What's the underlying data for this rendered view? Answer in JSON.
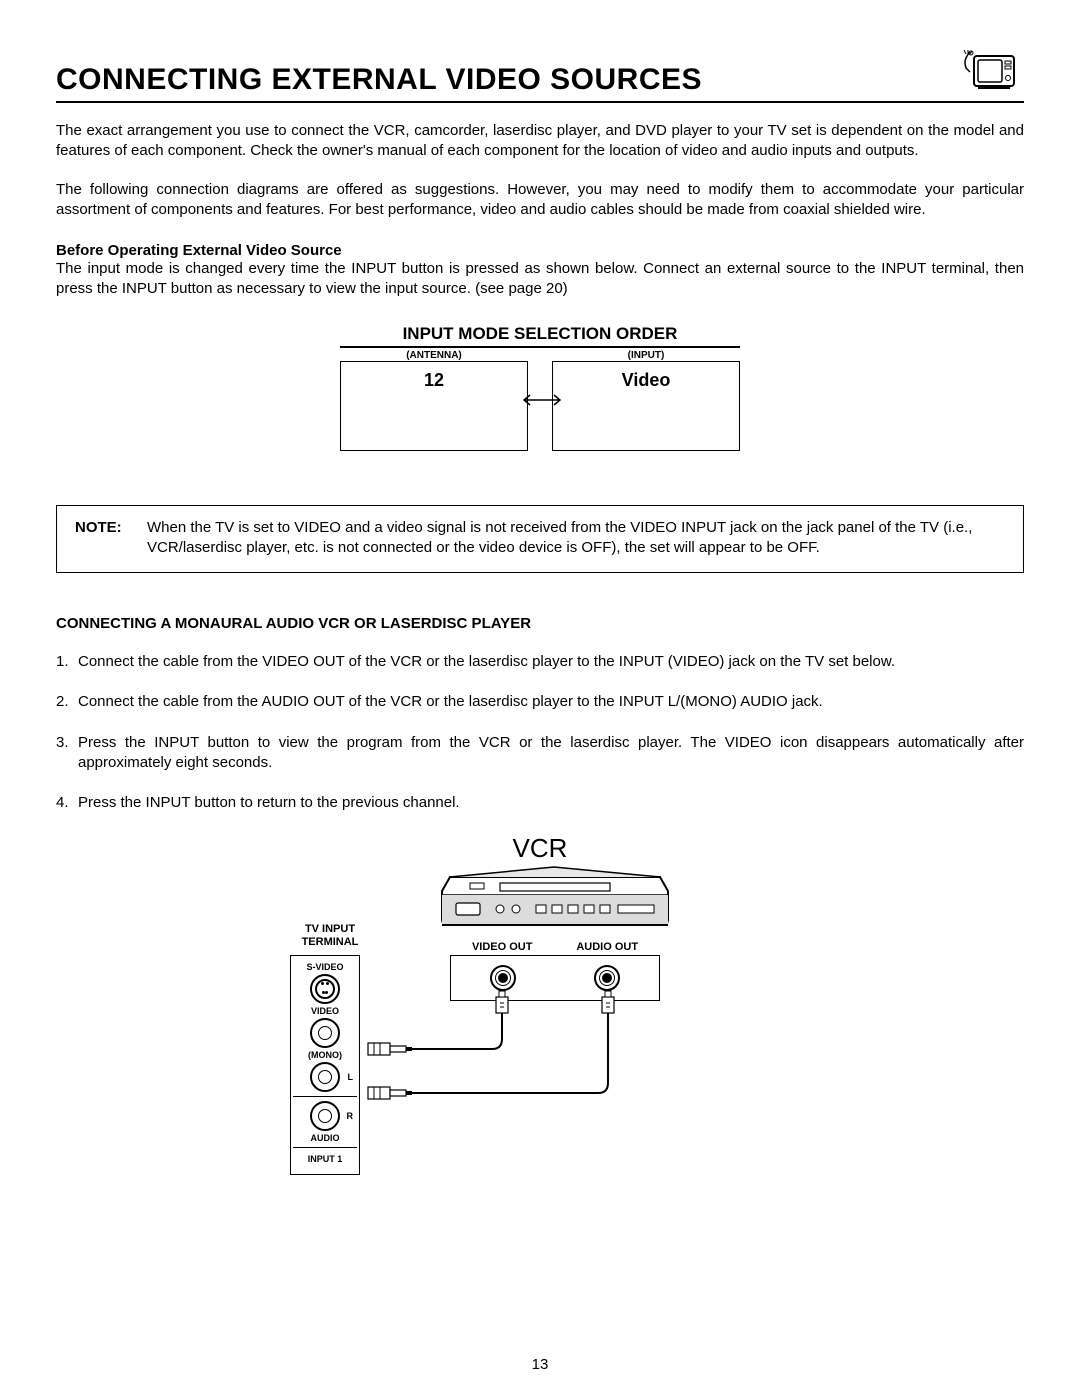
{
  "header": {
    "title": "CONNECTING EXTERNAL VIDEO SOURCES"
  },
  "intro": {
    "p1": "The exact arrangement you use to connect the VCR, camcorder, laserdisc player, and DVD player to your TV set is dependent on the model and features of each component.  Check the owner's manual of each component for the location of video and audio inputs and outputs.",
    "p2": "The following connection diagrams are offered as suggestions.  However, you may need to modify them to accommodate your particular assortment of components and features.  For best performance, video and audio cables should be made from coaxial shielded wire."
  },
  "before": {
    "heading": "Before Operating External Video Source",
    "body": "The input mode is changed every time the INPUT button is pressed as shown below.  Connect an external source to the INPUT terminal, then press the INPUT button as necessary to view the input source.  (see page 20)"
  },
  "mode": {
    "caption": "INPUT MODE SELECTION ORDER",
    "left_label": "(ANTENNA)",
    "left_value": "12",
    "right_label": "(INPUT)",
    "right_value": "Video"
  },
  "note": {
    "label": "NOTE:",
    "body": "When the TV is set to VIDEO and a video signal is not received from the VIDEO INPUT jack on the jack panel of the TV (i.e., VCR/laserdisc player, etc. is not connected or the video device is OFF), the set will appear to be OFF."
  },
  "connecting": {
    "heading": "CONNECTING A MONAURAL AUDIO VCR OR LASERDISC PLAYER",
    "steps": [
      "Connect the cable from the VIDEO OUT of the VCR or the laserdisc player to the INPUT (VIDEO) jack on the TV set below.",
      "Connect the cable from the AUDIO OUT of the VCR or the laserdisc player to the INPUT L/(MONO) AUDIO jack.",
      "Press the INPUT button to view the program from the VCR or the laserdisc player.  The VIDEO icon disappears automatically after approximately eight seconds.",
      "Press the INPUT button to return to the previous channel."
    ]
  },
  "diagram": {
    "vcr_title": "VCR",
    "tv_input_label": "TV INPUT TERMINAL",
    "video_out": "VIDEO OUT",
    "audio_out": "AUDIO OUT",
    "svideo": "S-VIDEO",
    "video": "VIDEO",
    "mono": "(MONO)",
    "audio": "AUDIO",
    "input1": "INPUT 1",
    "L": "L",
    "R": "R"
  },
  "page_number": "13"
}
